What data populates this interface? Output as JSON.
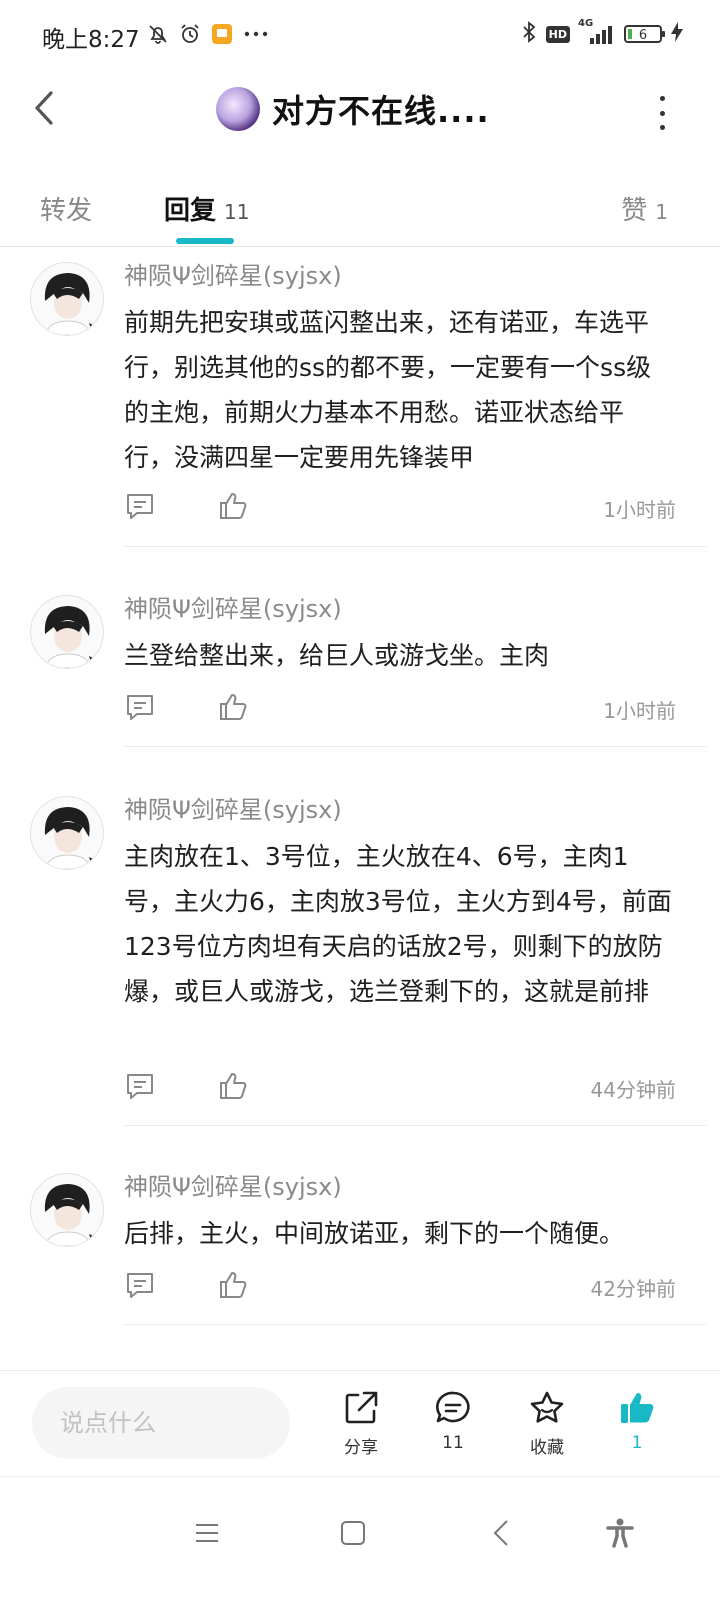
{
  "status_bar": {
    "time": "晚上8:27",
    "network": "4G",
    "hd_label": "HD",
    "battery": "6",
    "icons": [
      "mute-bell-icon",
      "alarm-icon",
      "app-notification-icon",
      "more-dots-icon",
      "bluetooth-icon",
      "hd-icon",
      "signal-icon",
      "battery-icon",
      "charging-icon"
    ]
  },
  "header": {
    "title": "对方不在线....",
    "back_icon": "chevron-left-icon",
    "more_icon": "more-vertical-icon"
  },
  "tabs": {
    "forward": "转发",
    "reply": "回复",
    "reply_count": "11",
    "like": "赞",
    "like_count": "1",
    "accent_color": "#19b8c7"
  },
  "comments": [
    {
      "author": "神陨Ψ剑碎星(syjsx)",
      "content": "前期先把安琪或蓝闪整出来，还有诺亚，车选平行，别选其他的ss的都不要，一定要有一个ss级的主炮，前期火力基本不用愁。诺亚状态给平行，没满四星一定要用先锋装甲",
      "time": "1小时前"
    },
    {
      "author": "神陨Ψ剑碎星(syjsx)",
      "content": "兰登给整出来，给巨人或游戈坐。主肉",
      "time": "1小时前"
    },
    {
      "author": "神陨Ψ剑碎星(syjsx)",
      "content": "主肉放在1、3号位，主火放在4、6号，主肉1号，主火力6，主肉放3号位，主火方到4号，前面123号位方肉坦有天启的话放2号，则剩下的放防爆，或巨人或游戈，选兰登剩下的，这就是前排",
      "time": "44分钟前"
    },
    {
      "author": "神陨Ψ剑碎星(syjsx)",
      "content": "后排，主火，中间放诺亚，剩下的一个随便。",
      "time": "42分钟前"
    }
  ],
  "bottom_bar": {
    "input_placeholder": "说点什么",
    "share_label": "分享",
    "comments_count": "11",
    "favorite_label": "收藏",
    "like_count": "1"
  },
  "nav_bar": {
    "icons": [
      "menu-icon",
      "home-square-icon",
      "back-chevron-icon",
      "accessibility-icon"
    ]
  }
}
